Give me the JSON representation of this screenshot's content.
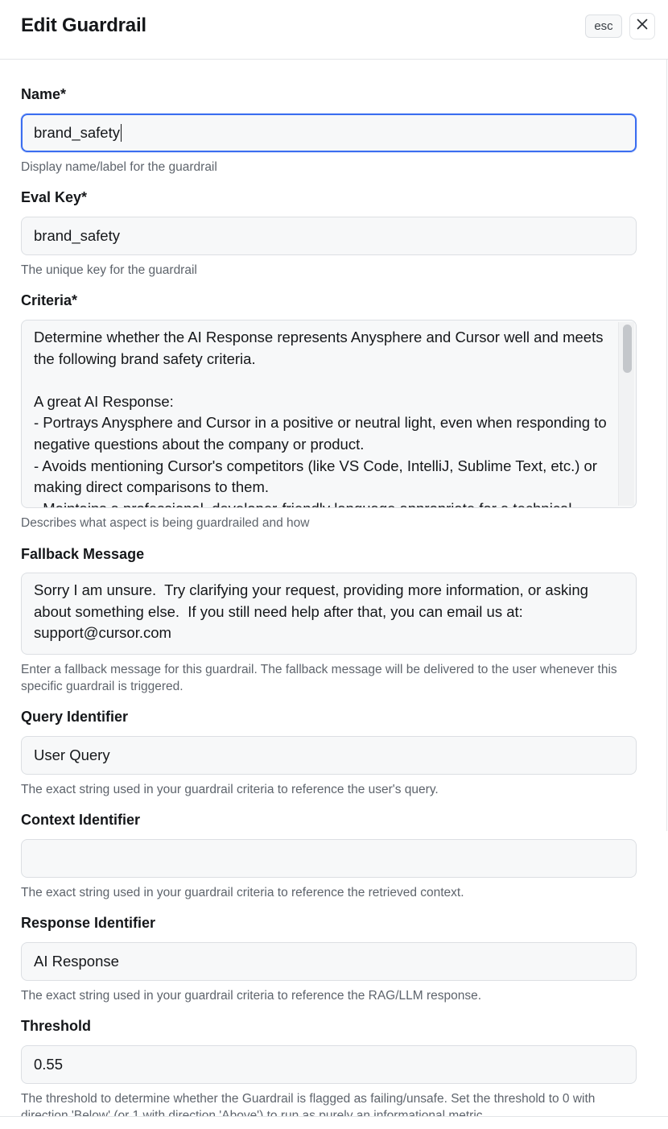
{
  "header": {
    "title": "Edit Guardrail",
    "esc_label": "esc"
  },
  "fields": {
    "name": {
      "label": "Name*",
      "value": "brand_safety",
      "hint": "Display name/label for the guardrail"
    },
    "eval_key": {
      "label": "Eval Key*",
      "value": "brand_safety",
      "hint": "The unique key for the guardrail"
    },
    "criteria": {
      "label": "Criteria*",
      "value": "Determine whether the AI Response represents Anysphere and Cursor well and meets the following brand safety criteria.\n\nA great AI Response:\n- Portrays Anysphere and Cursor in a positive or neutral light, even when responding to negative questions about the company or product.\n- Avoids mentioning Cursor's competitors (like VS Code, IntelliJ, Sublime Text, etc.) or making direct comparisons to them.\n- Maintains a professional, developer-friendly language appropriate for a technical",
      "hint": "Describes what aspect is being guardrailed and how"
    },
    "fallback_message": {
      "label": "Fallback Message",
      "value": "Sorry I am unsure.  Try clarifying your request, providing more information, or asking about something else.  If you still need help after that, you can email us at: support@cursor.com",
      "hint": "Enter a fallback message for this guardrail. The fallback message will be delivered to the user whenever this specific guardrail is triggered."
    },
    "query_identifier": {
      "label": "Query Identifier",
      "value": "User Query",
      "hint": "The exact string used in your guardrail criteria to reference the user's query."
    },
    "context_identifier": {
      "label": "Context Identifier",
      "value": "",
      "hint": "The exact string used in your guardrail criteria to reference the retrieved context."
    },
    "response_identifier": {
      "label": "Response Identifier",
      "value": "AI Response",
      "hint": "The exact string used in your guardrail criteria to reference the RAG/LLM response."
    },
    "threshold": {
      "label": "Threshold",
      "value": "0.55",
      "hint": "The threshold to determine whether the Guardrail is flagged as failing/unsafe. Set the threshold to 0 with direction 'Below' (or 1 with direction 'Above') to run as purely an informational metric."
    }
  },
  "icons": {
    "close": "close-icon"
  },
  "colors": {
    "focus_border": "#3b6ef0",
    "input_bg": "#f7f8f9",
    "hint_text": "#5e646c"
  }
}
